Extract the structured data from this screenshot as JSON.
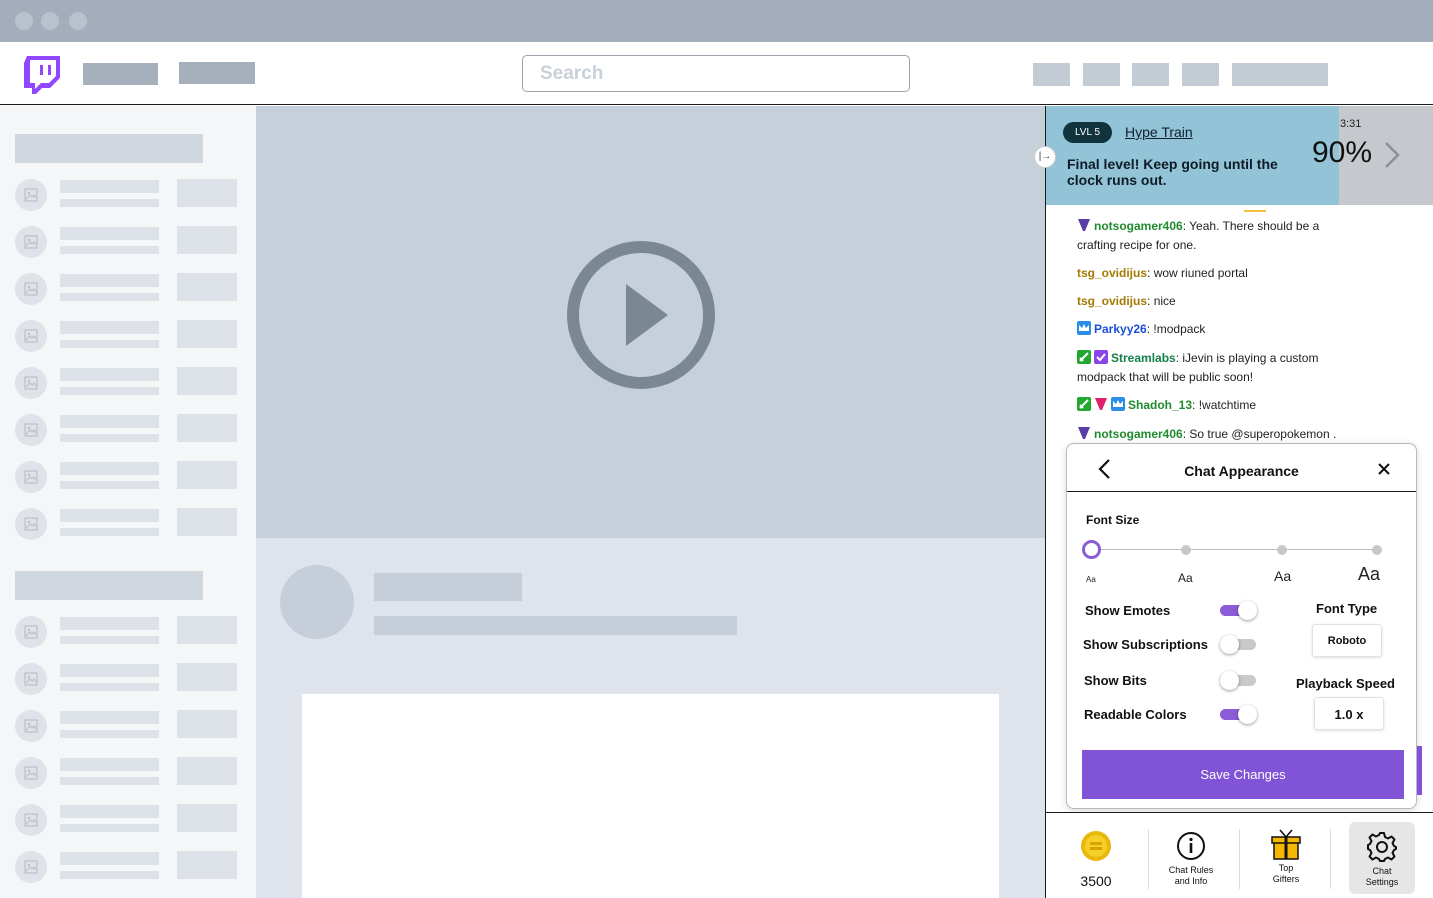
{
  "search": {
    "placeholder": "Search"
  },
  "hype_train": {
    "level": "LVL 5",
    "title": "Hype Train",
    "message": "Final level! Keep going until the clock runs out.",
    "time": "3:31",
    "percent": "90%"
  },
  "chat": {
    "messages": [
      {
        "user": "notsogamer406",
        "color": "#1f8a2e",
        "text": "Yeah. There should be a crafting recipe for one."
      },
      {
        "user": "tsg_ovidijus",
        "color": "#a37a05",
        "text": "wow riuned portal"
      },
      {
        "user": "tsg_ovidijus",
        "color": "#a37a05",
        "text": "nice"
      },
      {
        "user": "Parkyy26",
        "color": "#1d4ed8",
        "text": "!modpack"
      },
      {
        "user": "Streamlabs",
        "color": "#14804a",
        "text": "iJevin is playing a custom modpack that will be public soon!"
      },
      {
        "user": "Shadoh_13",
        "color": "#1f8a2e",
        "text": "!watchtime"
      },
      {
        "user": "notsogamer406",
        "color": "#1f8a2e",
        "text": "So true @superopokemon ."
      }
    ]
  },
  "appearance": {
    "title": "Chat Appearance",
    "font_size_label": "Font Size",
    "font_size_options": [
      "Aa",
      "Aa",
      "Aa",
      "Aa"
    ],
    "font_size_selected_index": 0,
    "toggles": [
      {
        "label": "Show Emotes",
        "on": true
      },
      {
        "label": "Show Subscriptions",
        "on": false
      },
      {
        "label": "Show Bits",
        "on": false
      },
      {
        "label": "Readable Colors",
        "on": true
      }
    ],
    "font_type_label": "Font Type",
    "font_type_value": "Roboto",
    "playback_label": "Playback Speed",
    "playback_value": "1.0 x",
    "save_label": "Save Changes"
  },
  "bottom_bar": {
    "bits": "3500",
    "rules_line1": "Chat Rules",
    "rules_line2": "and Info",
    "gifters_line1": "Top",
    "gifters_line2": "Gifters",
    "settings_line1": "Chat",
    "settings_line2": "Settings"
  },
  "colors": {
    "accent": "#8153d6",
    "hype_bg": "#93c3d6",
    "toggle_on": "#8a5cd6"
  }
}
